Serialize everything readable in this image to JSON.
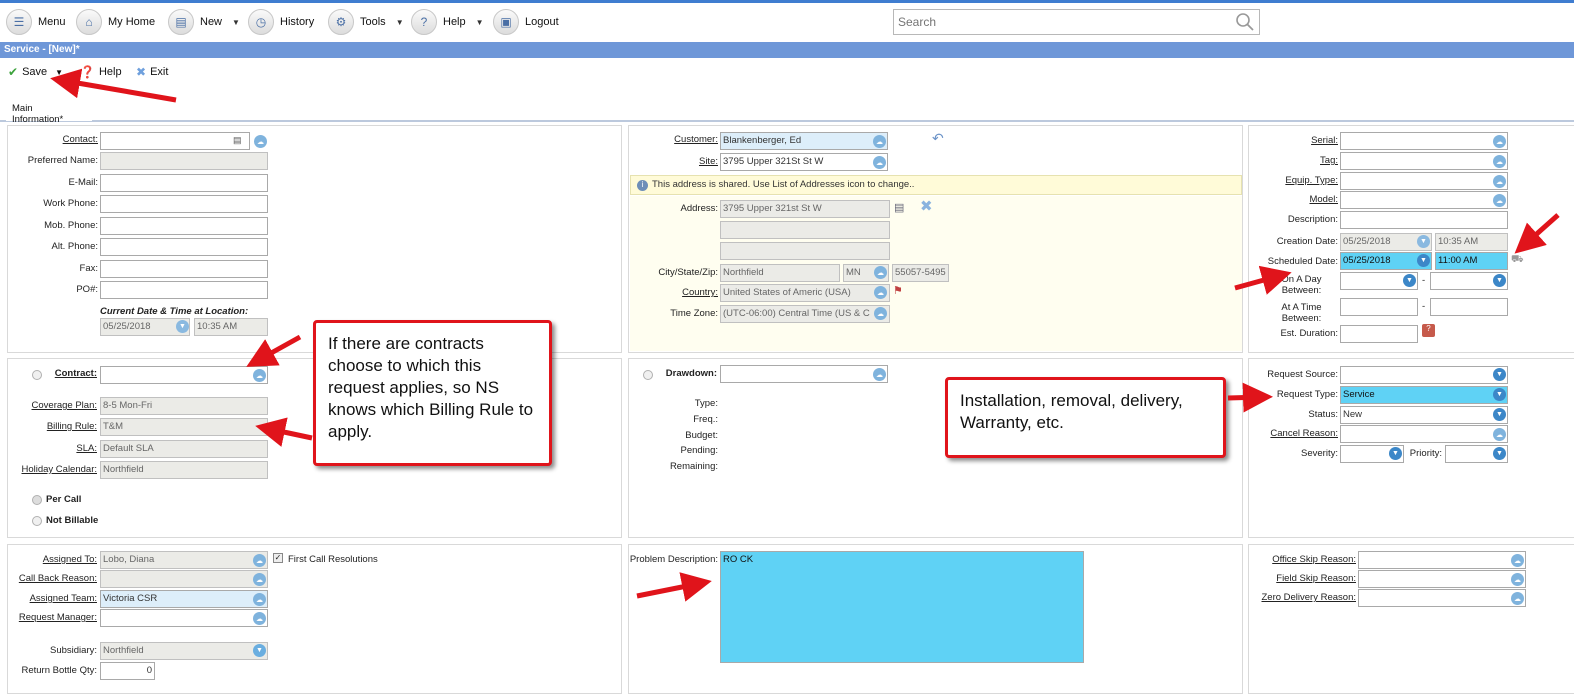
{
  "menu": {
    "items": [
      {
        "label": "Menu",
        "icon": "menu-icon"
      },
      {
        "label": "My Home",
        "icon": "home-icon"
      },
      {
        "label": "New",
        "icon": "new-document-icon"
      },
      {
        "label": "History",
        "icon": "history-icon"
      },
      {
        "label": "Tools",
        "icon": "tools-icon"
      },
      {
        "label": "Help",
        "icon": "help-icon"
      },
      {
        "label": "Logout",
        "icon": "logout-icon"
      }
    ],
    "search_placeholder": "Search"
  },
  "title": "Service - [New]*",
  "toolbar": {
    "save": "Save",
    "help": "Help",
    "exit": "Exit"
  },
  "tabs": {
    "main": "Main Information*"
  },
  "contact_panel": {
    "contact": "Contact:",
    "preferred_name": "Preferred Name:",
    "email": "E-Mail:",
    "work_phone": "Work Phone:",
    "mob_phone": "Mob. Phone:",
    "alt_phone": "Alt. Phone:",
    "fax": "Fax:",
    "po": "PO#:",
    "current_dt_label": "Current Date & Time at Location:",
    "current_date": "05/25/2018",
    "current_time": "10:35 AM"
  },
  "customer_panel": {
    "customer_label": "Customer:",
    "customer": "Blankenberger, Ed",
    "site_label": "Site:",
    "site": "3795 Upper 321St St W",
    "shared_note": "This address is shared. Use List of Addresses icon to change..",
    "address_label": "Address:",
    "address": "3795 Upper 321st St W",
    "csz_label": "City/State/Zip:",
    "city": "Northfield",
    "state": "MN",
    "zip": "55057-5495",
    "country_label": "Country:",
    "country": "United States of Americ (USA)",
    "tz_label": "Time Zone:",
    "tz": "(UTC-06:00) Central Time (US & C"
  },
  "equipment_panel": {
    "serial": "Serial:",
    "tag": "Tag:",
    "equip_type": "Equip. Type:",
    "model": "Model:",
    "description": "Description:",
    "creation_label": "Creation Date:",
    "creation_date": "05/25/2018",
    "creation_time": "10:35 AM",
    "scheduled_label": "Scheduled Date:",
    "scheduled_date": "05/25/2018",
    "scheduled_time": "11:00 AM",
    "on_a_day": "On A Day Between:",
    "at_a_time": "At A Time Between:",
    "dash": "-",
    "est_duration": "Est. Duration:"
  },
  "contract_panel": {
    "contract": "Contract:",
    "coverage_label": "Coverage Plan:",
    "coverage": "8-5 Mon-Fri",
    "billing_label": "Billing Rule:",
    "billing": "T&M",
    "sla_label": "SLA:",
    "sla": "Default SLA",
    "holiday_label": "Holiday Calendar:",
    "holiday": "Northfield",
    "per_call": "Per Call",
    "not_billable": "Not Billable"
  },
  "drawdown_panel": {
    "drawdown": "Drawdown:",
    "type": "Type:",
    "freq": "Freq.:",
    "budget": "Budget:",
    "pending": "Pending:",
    "remaining": "Remaining:"
  },
  "request_panel": {
    "source": "Request Source:",
    "type_label": "Request Type:",
    "type": "Service",
    "status_label": "Status:",
    "status": "New",
    "cancel_reason": "Cancel Reason:",
    "severity": "Severity:",
    "priority": "Priority:"
  },
  "assign_panel": {
    "assigned_to_label": "Assigned To:",
    "assigned_to": "Lobo, Diana",
    "first_call": "First Call Resolutions",
    "call_back": "Call Back Reason:",
    "team_label": "Assigned Team:",
    "team": "Victoria CSR",
    "req_manager": "Request Manager:",
    "subsidiary_label": "Subsidiary:",
    "subsidiary": "Northfield",
    "bottle_label": "Return Bottle Qty:",
    "bottle": "0"
  },
  "problem_panel": {
    "label": "Problem Description:",
    "value": "RO CK"
  },
  "skip_panel": {
    "office": "Office Skip Reason:",
    "field": "Field Skip Reason:",
    "zero": "Zero Delivery Reason:"
  },
  "callouts": {
    "contracts": "If there are contracts choose to which this request applies, so NS knows which Billing Rule to apply.",
    "request_type": "Installation, removal, delivery, Warranty, etc."
  },
  "colors": {
    "accent": "#6e97d8",
    "highlight": "#5fd2f5",
    "callout_border": "#e0141b"
  }
}
